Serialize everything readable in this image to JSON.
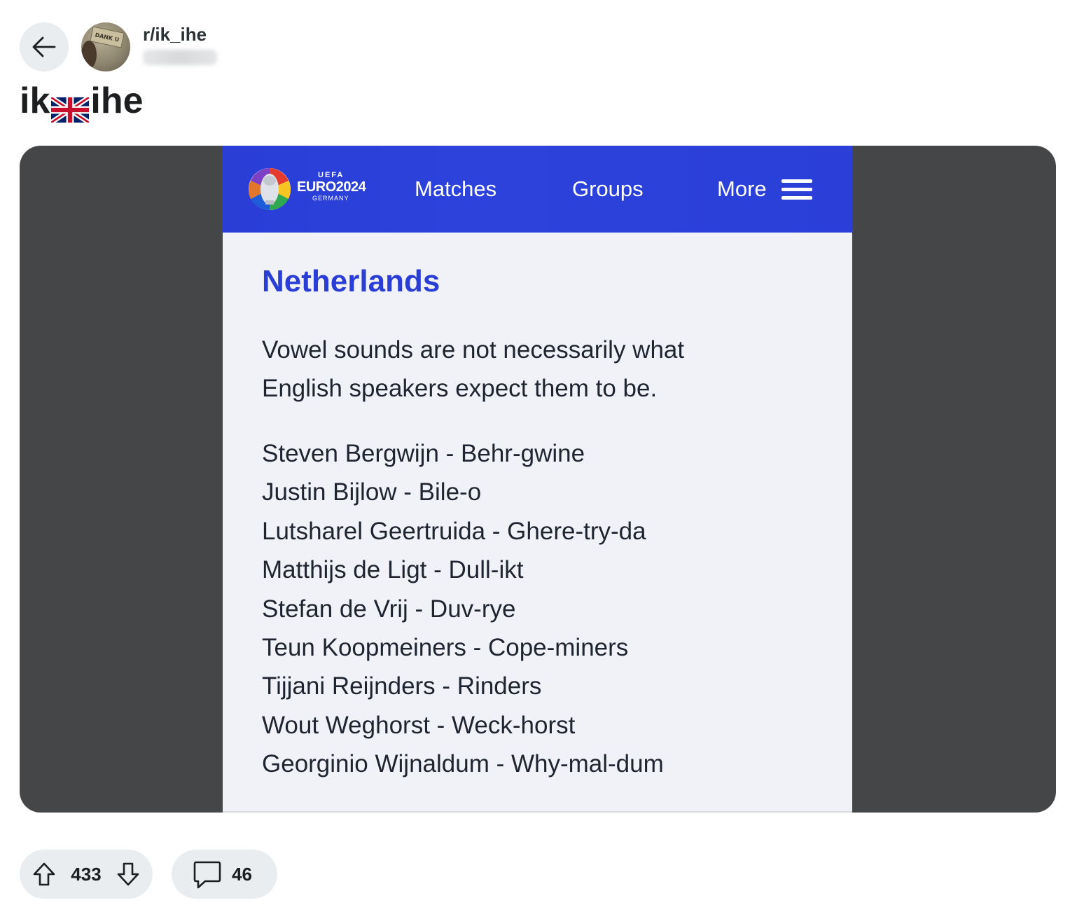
{
  "header": {
    "back_icon": "arrow-left-icon",
    "avatar_sign_text": "DANK U",
    "subreddit": "r/ik_ihe"
  },
  "post": {
    "title_before": "ik",
    "title_flag": "uk-flag-emoji",
    "title_after": "ihe"
  },
  "screenshot": {
    "brand": {
      "uefa": "UEFA",
      "euro": "EURO2024",
      "country": "GERMANY"
    },
    "nav": {
      "matches": "Matches",
      "groups": "Groups",
      "more": "More",
      "menu_icon": "hamburger-icon"
    },
    "heading": "Netherlands",
    "intro": "Vowel sounds are not necessarily what English speakers expect them to be.",
    "players": [
      "Steven Bergwijn - Behr-gwine",
      "Justin Bijlow - Bile-o",
      "Lutsharel Geertruida - Ghere-try-da",
      "Matthijs de Ligt - Dull-ikt",
      "Stefan de Vrij - Duv-rye",
      "Teun Koopmeiners - Cope-miners",
      "Tijjani Reijnders - Rinders",
      "Wout Weghorst - Weck-horst",
      "Georginio Wijnaldum - Why-mal-dum"
    ],
    "colors": {
      "nav_bar": "#2a3ed6",
      "heading": "#2a3ed6",
      "background": "#f0f2f7"
    }
  },
  "actions": {
    "upvote_icon": "upvote-arrow-icon",
    "score": "433",
    "downvote_icon": "downvote-arrow-icon",
    "comment_icon": "comment-bubble-icon",
    "comment_count": "46"
  }
}
